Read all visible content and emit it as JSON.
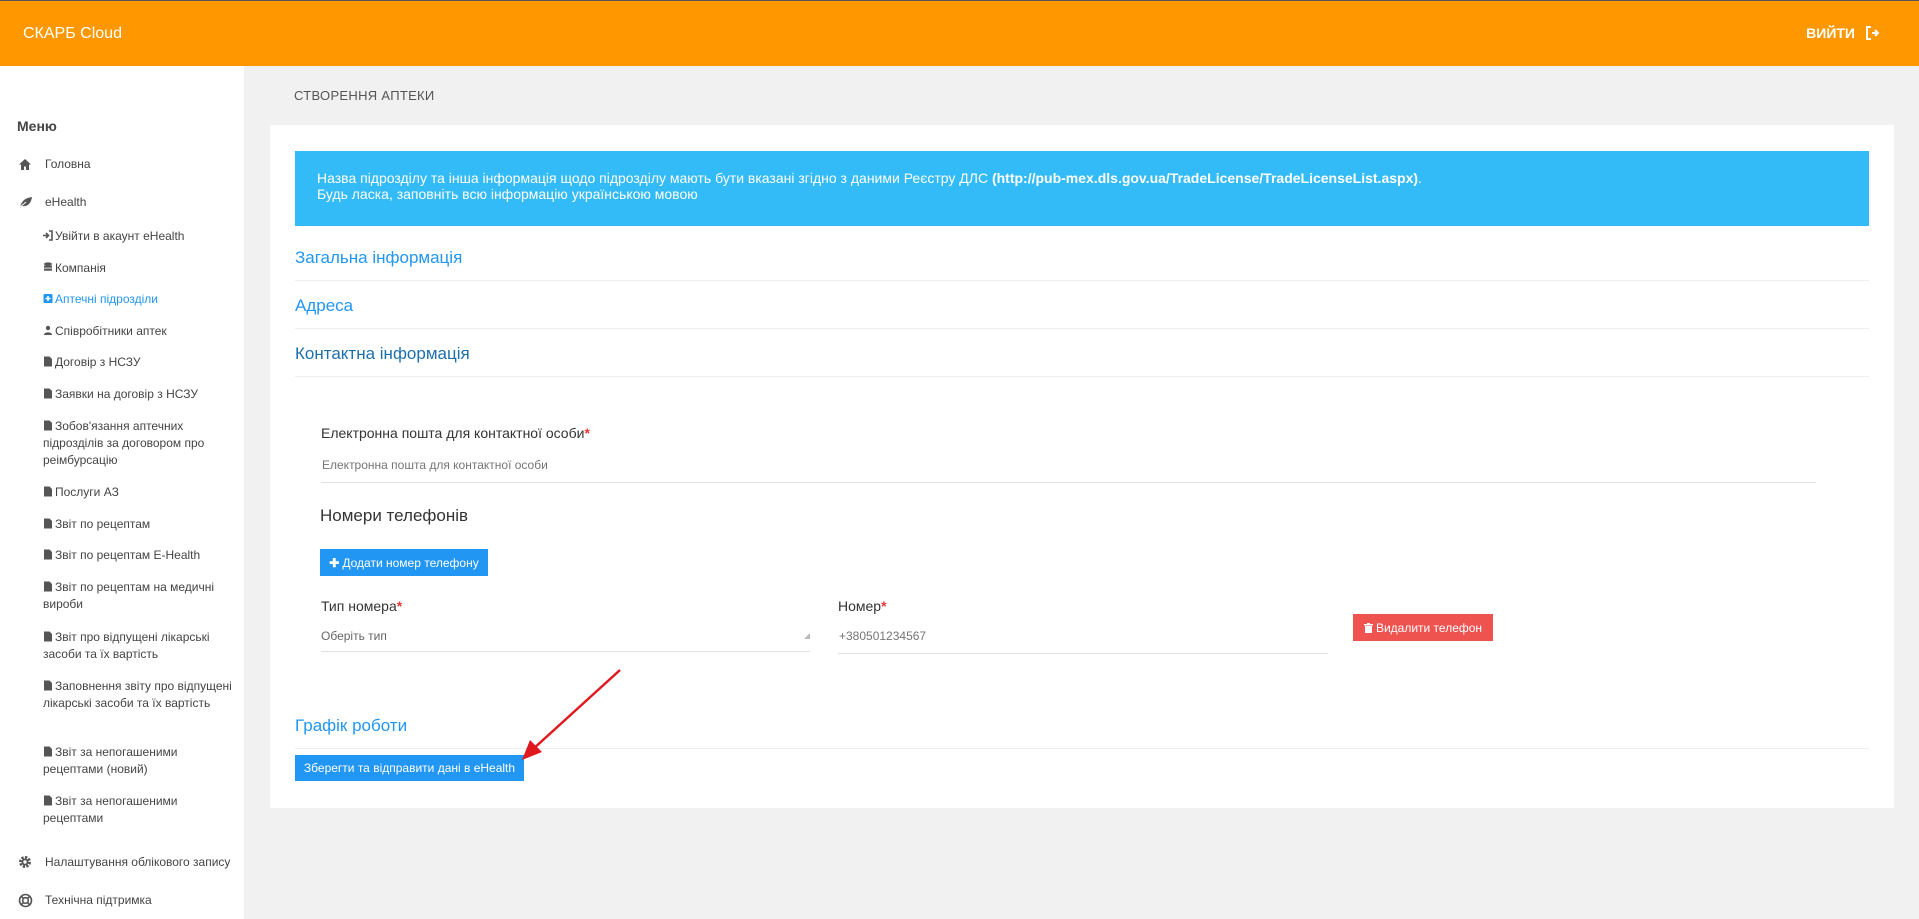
{
  "header": {
    "brand": "СКАРБ Cloud",
    "logout_label": "ВИЙТИ"
  },
  "sidebar": {
    "menu_title": "Меню",
    "main_items": [
      {
        "label": "Головна",
        "icon": "home-icon"
      },
      {
        "label": "eHealth",
        "icon": "leaf-icon"
      },
      {
        "label": "Налаштування облікового запису",
        "icon": "gear-icon"
      },
      {
        "label": "Технічна підтримка",
        "icon": "lifebuoy-icon"
      }
    ],
    "sub_items": [
      {
        "label": "Увійти в акаунт eHealth",
        "icon": "sign-in-icon"
      },
      {
        "label": "Компанія",
        "icon": "database-icon"
      },
      {
        "label": "Аптечні підрозділи",
        "icon": "plus-square-icon",
        "active": true
      },
      {
        "label": "Співробітники аптек",
        "icon": "user-icon"
      },
      {
        "label": "Договір з НСЗУ",
        "icon": "file-icon"
      },
      {
        "label": "Заявки на договір з НСЗУ",
        "icon": "file-icon"
      },
      {
        "label": "Зобов'язання аптечних підрозділів за договором про реімбурсацію",
        "icon": "file-icon"
      },
      {
        "label": "Послуги АЗ",
        "icon": "file-icon"
      },
      {
        "label": "Звіт по рецептам",
        "icon": "file-icon"
      },
      {
        "label": "Звіт по рецептам E-Health",
        "icon": "file-icon"
      },
      {
        "label": "Звіт по рецептам на медичні вироби",
        "icon": "file-icon"
      },
      {
        "label": "Звіт про відпущені лікарські засоби та їх вартість",
        "icon": "file-icon"
      },
      {
        "label": "Заповнення звіту про відпущені лікарські засоби та їх вартість",
        "icon": "file-icon"
      },
      {
        "label": "Звіт за непогашеними рецептами (новий)",
        "icon": "file-icon"
      },
      {
        "label": "Звіт за непогашеними рецептами",
        "icon": "file-icon"
      }
    ]
  },
  "main": {
    "page_title": "СТВОРЕННЯ АПТЕКИ",
    "info": {
      "line1_prefix": "Назва підрозділу та інша інформація щодо підрозділу мають бути вказані згідно з даними Реєстру ДЛС ",
      "line1_link": "(http://pub-mex.dls.gov.ua/TradeLicense/TradeLicenseList.aspx)",
      "line1_suffix": ".",
      "line2": "Будь ласка, заповніть всю інформацію українською мовою"
    },
    "sections": {
      "general": "Загальна інформація",
      "address": "Адреса",
      "contact": "Контактна інформація",
      "schedule": "Графік роботи"
    },
    "contact": {
      "email_label": "Електронна пошта для контактної особи",
      "email_placeholder": "Електронна пошта для контактної особи",
      "required_mark": "*",
      "phones_title": "Номери телефонів",
      "add_phone_label": "Додати номер телефону",
      "phone_type_label": "Тип номера",
      "phone_type_value": "Оберіть тип",
      "phone_number_label": "Номер",
      "phone_number_placeholder": "+380501234567",
      "delete_phone_label": "Видалити телефон"
    },
    "save_label": "Зберегти та відправити дані в eHealth"
  },
  "colors": {
    "header": "#ff9800",
    "primary": "#2196f3",
    "info": "#33bbf7",
    "danger": "#ef5350",
    "annotation_arrow": "#e0191f"
  }
}
